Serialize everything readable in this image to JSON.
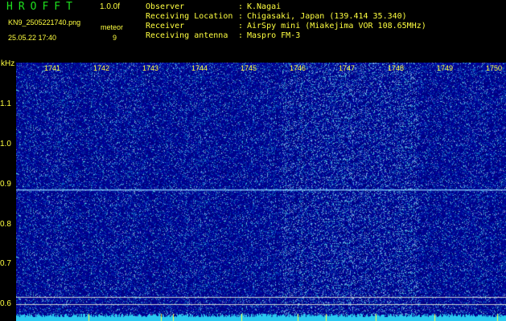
{
  "header": {
    "app_title": "HROFFT",
    "version": "1.0.0f",
    "filename": "KN9_2505221740.png",
    "datetime": "25.05.22 17:40",
    "meteor_label": "meteor",
    "meteor_count": "9"
  },
  "info": {
    "observer_label": "Observer",
    "observer_value": "K.Nagai",
    "location_label": "Receiving Location",
    "location_value": "Chigasaki, Japan (139.414 35.340)",
    "receiver_label": "Receiver",
    "receiver_value": "AirSpy mini (Miakejima VOR 108.65MHz)",
    "antenna_label": "Receiving antenna",
    "antenna_value": "Maspro FM-3",
    "separator": ":"
  },
  "axis": {
    "y_unit": "kHz",
    "y_ticks": [
      "1.1",
      "1.0",
      "0.9",
      "0.8",
      "0.7",
      "0.6"
    ],
    "x_ticks": [
      "1741",
      "1742",
      "1743",
      "1744",
      "1745",
      "1746",
      "1747",
      "1748",
      "1749",
      "1750"
    ]
  },
  "colors": {
    "label": "#ffff40",
    "title": "#1ee01e",
    "background": "#000000",
    "spectrogram_base": "#00008c",
    "carrier_line": "#8fd7ff",
    "marker_line": "#d0d0d0",
    "noise_floor": "#29c9f0"
  }
}
